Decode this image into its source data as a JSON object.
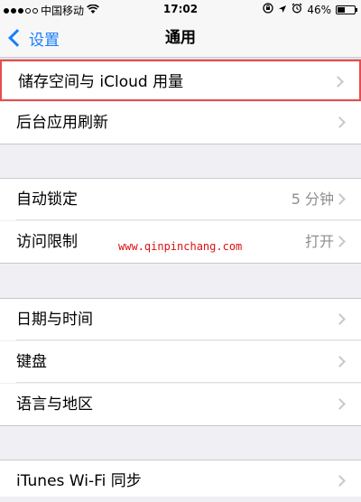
{
  "status_bar": {
    "carrier": "中国移动",
    "time": "17:02",
    "battery": "46%",
    "battery_level": 0.46,
    "icons": [
      "signal-icon",
      "wifi-icon",
      "lock-rotation-icon",
      "location-icon",
      "alarm-icon",
      "battery-icon"
    ]
  },
  "nav": {
    "back_label": "设置",
    "title": "通用"
  },
  "rows": {
    "storage": {
      "label": "储存空间与 iCloud 用量"
    },
    "background_refresh": {
      "label": "后台应用刷新"
    },
    "auto_lock": {
      "label": "自动锁定",
      "value": "5 分钟"
    },
    "restrictions": {
      "label": "访问限制",
      "value": "打开"
    },
    "date_time": {
      "label": "日期与时间"
    },
    "keyboard": {
      "label": "键盘"
    },
    "language_region": {
      "label": "语言与地区"
    },
    "itunes_sync": {
      "label": "iTunes Wi-Fi 同步"
    }
  },
  "watermark": "www.qinpinchang.com",
  "colors": {
    "accent": "#1a7dfa",
    "highlight_border": "#e74c4c",
    "watermark": "#dd1111",
    "background": "#efeff4"
  }
}
